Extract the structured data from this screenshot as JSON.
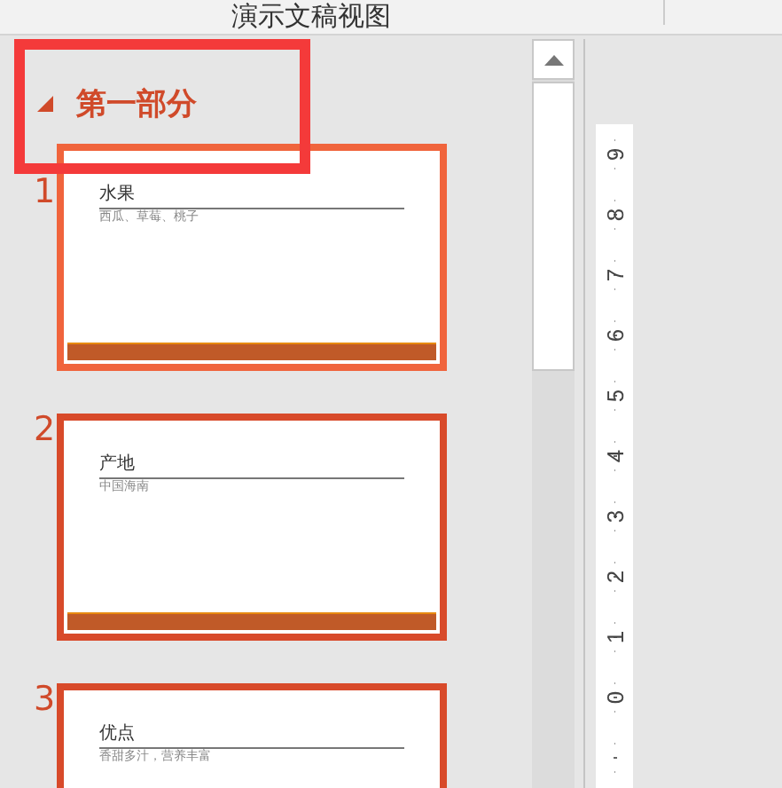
{
  "header": {
    "title": "演示文稿视图"
  },
  "section": {
    "title": "第一部分",
    "expanded": true
  },
  "slides": [
    {
      "number": "1",
      "title": "水果",
      "subtitle": "西瓜、草莓、桃子",
      "selected": true
    },
    {
      "number": "2",
      "title": "产地",
      "subtitle": "中国海南",
      "selected": false
    },
    {
      "number": "3",
      "title": "优点",
      "subtitle": "香甜多汁，营养丰富",
      "selected": false
    }
  ],
  "ruler": {
    "labels": [
      "9",
      "8",
      "7",
      "6",
      "5",
      "4",
      "3",
      "2",
      "1",
      "0"
    ]
  }
}
